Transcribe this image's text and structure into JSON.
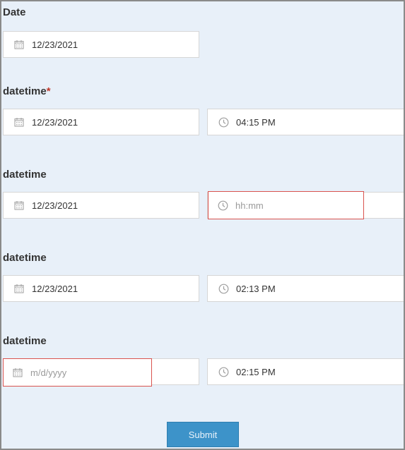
{
  "form": {
    "date_group": {
      "label": "Date",
      "date_value": "12/23/2021"
    },
    "datetime_groups": [
      {
        "label": "datetime",
        "required_marker": "*",
        "date_value": "12/23/2021",
        "time_value": "04:15 PM"
      },
      {
        "label": "datetime",
        "date_value": "12/23/2021",
        "time_placeholder": "hh:mm",
        "time_error": true
      },
      {
        "label": "datetime",
        "date_value": "12/23/2021",
        "time_value": "02:13 PM"
      },
      {
        "label": "datetime",
        "date_placeholder": "m/d/yyyy",
        "date_error": true,
        "time_value": "02:15 PM"
      }
    ],
    "submit_label": "Submit"
  },
  "icons": {
    "date": "calendar-icon",
    "time": "clock-icon"
  },
  "colors": {
    "background": "#e8f0f9",
    "error_border": "#d9534f",
    "required": "#c0392b",
    "submit": "#3d93c9"
  }
}
